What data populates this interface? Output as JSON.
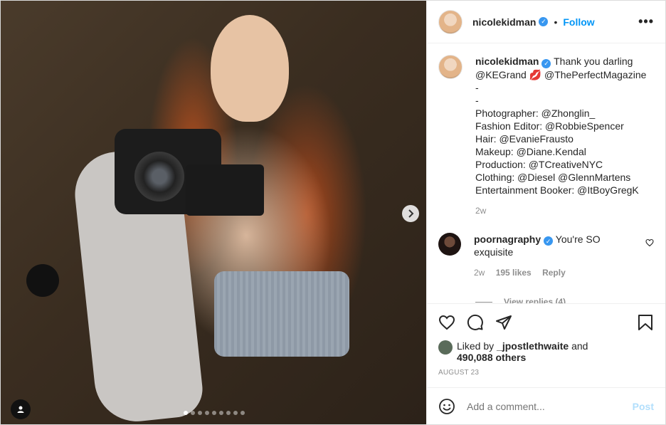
{
  "post": {
    "username": "nicolekidman",
    "follow_label": "Follow",
    "separator": "•",
    "more_label": "•••"
  },
  "caption": {
    "username": "nicolekidman",
    "lines": [
      "Thank you darling",
      "@KEGrand 💋 @ThePerfectMagazine",
      "-",
      "-",
      "Photographer: @Zhonglin_",
      "Fashion Editor: @RobbieSpencer",
      "Hair: @EvanieFrausto",
      "Makeup: @Diane.Kendal",
      "Production: @TCreativeNYC",
      "Clothing: @Diesel @GlennMartens",
      "Entertainment Booker: @ItBoyGregK"
    ],
    "age": "2w"
  },
  "comment": {
    "username": "poornagraphy",
    "text_line1": "You're SO",
    "text_line2": "exquisite",
    "age": "2w",
    "likes": "195 likes",
    "reply_label": "Reply",
    "view_replies": "View replies (4)"
  },
  "likes": {
    "prefix": "Liked by",
    "user": "_jpostlethwaite",
    "joiner": "and",
    "others": "490,088 others"
  },
  "date": "AUGUST 23",
  "add_comment": {
    "placeholder": "Add a comment...",
    "post_label": "Post"
  },
  "carousel": {
    "total": 9,
    "active": 0
  },
  "icons": {
    "more": "more-icon",
    "like": "heart-icon",
    "comment": "comment-icon",
    "share": "share-icon",
    "save": "bookmark-icon",
    "emoji": "emoji-icon",
    "next": "chevron-right-icon",
    "tag": "user-tag-icon"
  },
  "colors": {
    "accent": "#0095f6",
    "verified": "#3897f0",
    "muted": "#8e8e8e",
    "post_disabled": "#b2dffc"
  }
}
